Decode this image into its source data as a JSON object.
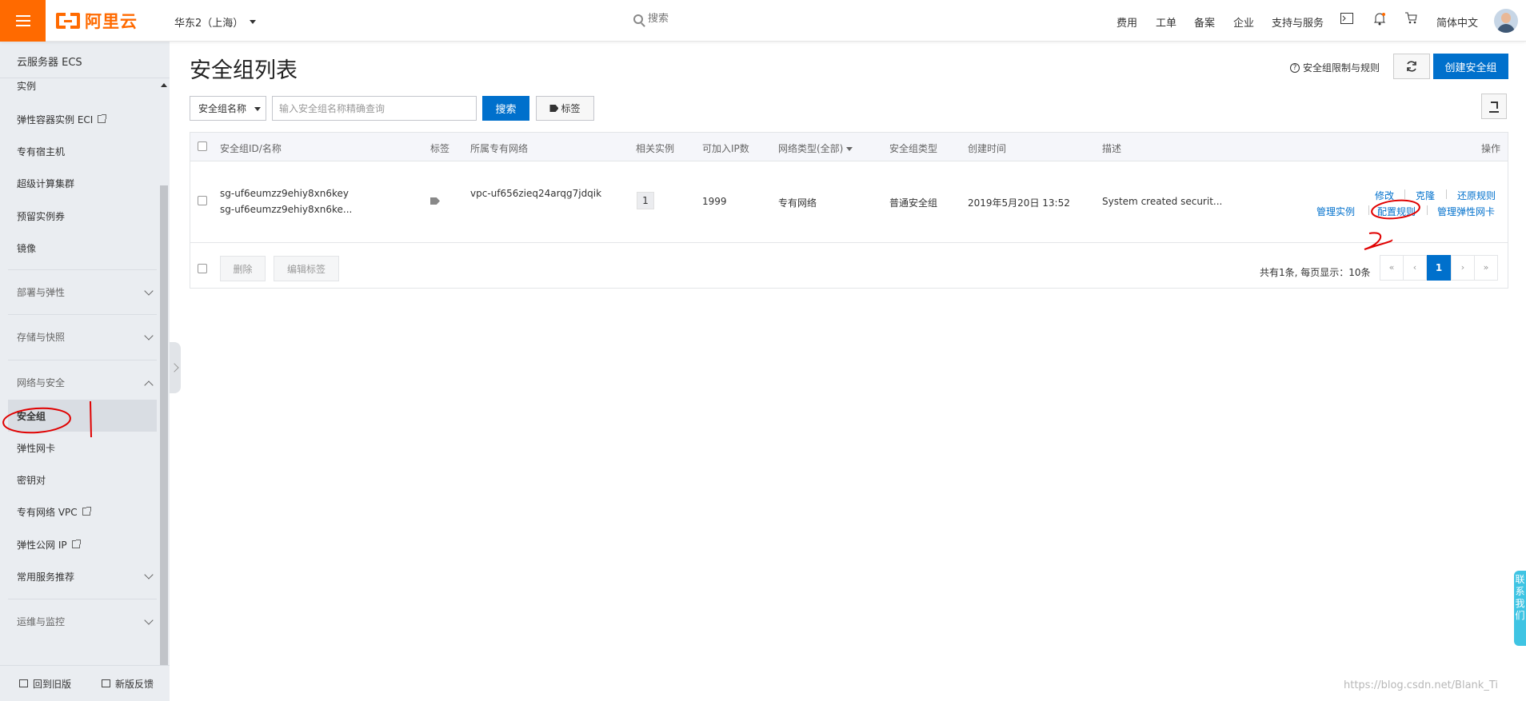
{
  "topbar": {
    "logo_text": "阿里云",
    "region": "华东2（上海）",
    "search_placeholder": "搜索",
    "nav": [
      "费用",
      "工单",
      "备案",
      "企业",
      "支持与服务"
    ],
    "language": "简体中文"
  },
  "sidebar": {
    "title": "云服务器 ECS",
    "items": [
      "实例",
      "弹性容器实例 ECI",
      "专有宿主机",
      "超级计算集群",
      "预留实例券",
      "镜像"
    ],
    "groups": [
      "部署与弹性",
      "存储与快照",
      "网络与安全"
    ],
    "network_items": [
      "安全组",
      "弹性网卡",
      "密钥对",
      "专有网络 VPC",
      "弹性公网 IP"
    ],
    "common_services": "常用服务推荐",
    "ops_group": "运维与监控",
    "footer": {
      "old_version": "回到旧版",
      "feedback": "新版反馈"
    }
  },
  "main": {
    "title": "安全组列表",
    "help_link": "安全组限制与规则",
    "create_button": "创建安全组",
    "filter_select": "安全组名称",
    "query_placeholder": "输入安全组名称精确查询",
    "search_button": "搜索",
    "tag_button": "标签"
  },
  "table": {
    "headers": [
      "安全组ID/名称",
      "标签",
      "所属专有网络",
      "相关实例",
      "可加入IP数",
      "网络类型(全部)",
      "安全组类型",
      "创建时间",
      "描述",
      "操作"
    ],
    "rows": [
      {
        "id": "sg-uf6eumzz9ehiy8xn6key",
        "name": "sg-uf6eumzz9ehiy8xn6ke...",
        "vpc": "vpc-uf656zieq24arqg7jdqik",
        "instances": "1",
        "ip_count": "1999",
        "network_type": "专有网络",
        "sg_type": "普通安全组",
        "created": "2019年5月20日 13:52",
        "description": "System created securit...",
        "actions": [
          "修改",
          "克隆",
          "还原规则",
          "管理实例",
          "配置规则",
          "管理弹性网卡"
        ]
      }
    ],
    "footer": {
      "delete_button": "删除",
      "edit_tags_button": "编辑标签",
      "summary": "共有1条, 每页显示：10条",
      "pager": [
        "«",
        "‹",
        "1",
        "›",
        "»"
      ]
    }
  },
  "contact_tab": "联系我们",
  "watermark": "https://blog.csdn.net/Blank_Ti",
  "colors": {
    "brand": "#ff6a00",
    "primary": "#0070cc",
    "annotation": "#e00000"
  }
}
